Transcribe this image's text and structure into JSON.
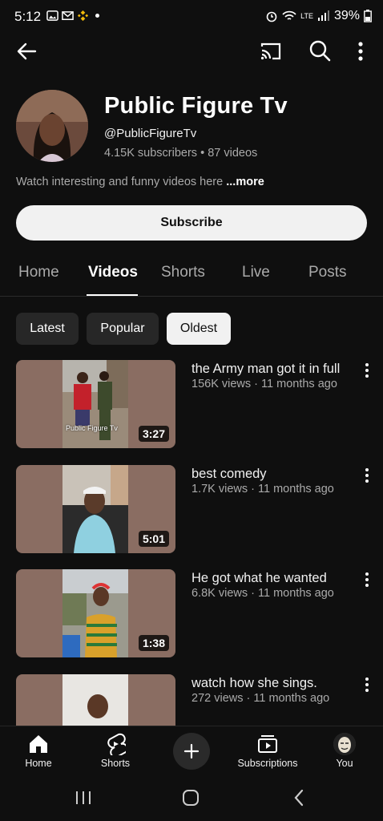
{
  "status_bar": {
    "time": "5:12",
    "battery": "39%",
    "network": "LTE"
  },
  "channel": {
    "name": "Public Figure Tv",
    "handle": "@PublicFigureTv",
    "subscribers": "4.15K subscribers",
    "separator": "•",
    "video_count": "87 videos",
    "description": "Watch interesting and funny videos here",
    "more_label": "...more"
  },
  "subscribe_label": "Subscribe",
  "tabs": [
    {
      "label": "Home"
    },
    {
      "label": "Videos"
    },
    {
      "label": "Shorts"
    },
    {
      "label": "Live"
    },
    {
      "label": "Posts"
    }
  ],
  "active_tab": "Videos",
  "chips": [
    {
      "label": "Latest"
    },
    {
      "label": "Popular"
    },
    {
      "label": "Oldest"
    }
  ],
  "selected_chip": "Oldest",
  "videos": [
    {
      "title": "the Army man got it in full",
      "meta": "156K views · 11 months ago",
      "duration": "3:27",
      "watermark": "Public Figure Tv"
    },
    {
      "title": "best comedy",
      "meta": "1.7K views · 11 months ago",
      "duration": "5:01"
    },
    {
      "title": "He got what he wanted",
      "meta": "6.8K views · 11 months ago",
      "duration": "1:38"
    },
    {
      "title": "watch how she sings.",
      "meta": "272 views · 11 months ago",
      "duration": ""
    }
  ],
  "bottom_nav": {
    "home": "Home",
    "shorts": "Shorts",
    "subscriptions": "Subscriptions",
    "you": "You"
  },
  "colors": {
    "background": "#0f0f0f",
    "chip_bg": "#272727",
    "secondary_text": "#aaaaaa"
  }
}
